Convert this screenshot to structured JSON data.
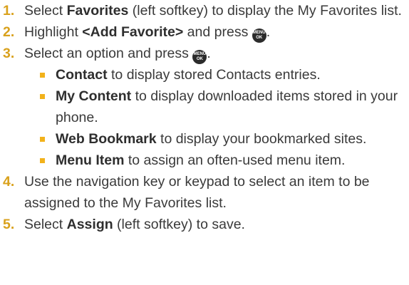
{
  "steps": [
    {
      "num": "1.",
      "parts": [
        {
          "t": "Select ",
          "b": false
        },
        {
          "t": "Favorites",
          "b": true
        },
        {
          "t": " (left softkey) to display the My Favorites list.",
          "b": false
        }
      ]
    },
    {
      "num": "2.",
      "parts": [
        {
          "t": "Highlight ",
          "b": false
        },
        {
          "t": "<Add Favorite>",
          "b": true
        },
        {
          "t": " and press ",
          "b": false
        }
      ],
      "key_after": true,
      "tail": "."
    },
    {
      "num": "3.",
      "parts": [
        {
          "t": "Select an option and press ",
          "b": false
        }
      ],
      "key_after": true,
      "tail": ".",
      "options": [
        {
          "label": "Contact",
          "desc": " to display stored Contacts entries."
        },
        {
          "label": "My Content",
          "desc": " to display downloaded items stored in your phone."
        },
        {
          "label": "Web Bookmark",
          "desc": " to display your bookmarked sites."
        },
        {
          "label": "Menu Item",
          "desc": " to assign an often-used menu item."
        }
      ]
    },
    {
      "num": "4.",
      "parts": [
        {
          "t": "Use the navigation key or keypad to select an item to be assigned to the My Favorites list.",
          "b": false
        }
      ]
    },
    {
      "num": "5.",
      "parts": [
        {
          "t": "Select ",
          "b": false
        },
        {
          "t": "Assign",
          "b": true
        },
        {
          "t": " (left softkey) to save.",
          "b": false
        }
      ]
    }
  ],
  "menu_key": {
    "icon": "menu-ok-key-icon",
    "top_text": "MENU",
    "bottom_text": "OK"
  },
  "colors": {
    "step_number": "#d9a11c",
    "bullet": "#f2b21b",
    "text": "#3a3a3a"
  }
}
